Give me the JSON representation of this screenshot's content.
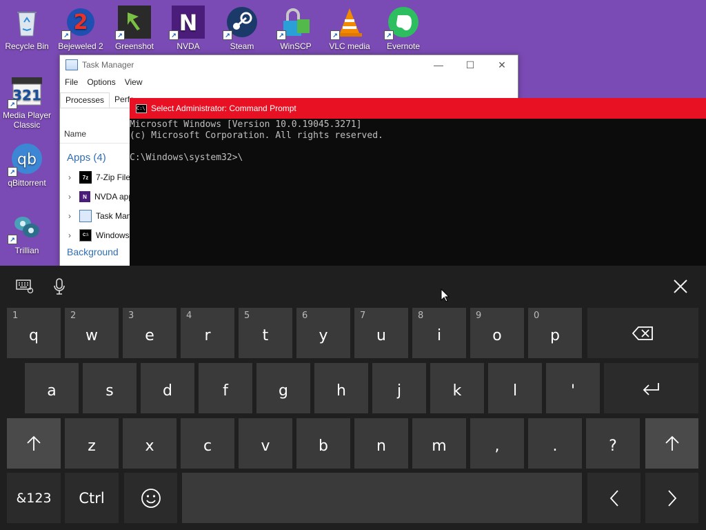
{
  "desktop": {
    "icons": [
      {
        "label": "Recycle Bin"
      },
      {
        "label": "Bejeweled 2"
      },
      {
        "label": "Greenshot"
      },
      {
        "label": "NVDA"
      },
      {
        "label": "Steam"
      },
      {
        "label": "WinSCP"
      },
      {
        "label": "VLC media"
      },
      {
        "label": "Evernote"
      },
      {
        "label": "Media Player Classic"
      },
      {
        "label": "qBittorrent"
      },
      {
        "label": "Trillian"
      }
    ]
  },
  "task_manager": {
    "title": "Task Manager",
    "menu": [
      "File",
      "Options",
      "View"
    ],
    "tabs": [
      "Processes",
      "Perfo"
    ],
    "column_name": "Name",
    "apps_group": "Apps (4)",
    "apps": [
      "7-Zip File",
      "NVDA app",
      "Task Man",
      "Windows"
    ],
    "background_group": "Background"
  },
  "cmd": {
    "title": "Select Administrator: Command Prompt",
    "lines": [
      "Microsoft Windows [Version 10.0.19045.3271]",
      "(c) Microsoft Corporation. All rights reserved.",
      "",
      "C:\\Windows\\system32>\\"
    ]
  },
  "keyboard": {
    "row1": [
      {
        "hint": "1",
        "label": "q"
      },
      {
        "hint": "2",
        "label": "w"
      },
      {
        "hint": "3",
        "label": "e"
      },
      {
        "hint": "4",
        "label": "r"
      },
      {
        "hint": "5",
        "label": "t"
      },
      {
        "hint": "6",
        "label": "y"
      },
      {
        "hint": "7",
        "label": "u"
      },
      {
        "hint": "8",
        "label": "i"
      },
      {
        "hint": "9",
        "label": "o"
      },
      {
        "hint": "0",
        "label": "p"
      }
    ],
    "row2": [
      "a",
      "s",
      "d",
      "f",
      "g",
      "h",
      "j",
      "k",
      "l",
      "'"
    ],
    "row3": [
      "z",
      "x",
      "c",
      "v",
      "b",
      "n",
      "m",
      ",",
      ".",
      "?"
    ],
    "symbols_label": "&123",
    "ctrl_label": "Ctrl",
    "backspace_icon": "backspace-icon",
    "enter_icon": "enter-icon",
    "shift_icon": "shift-up-arrow-icon",
    "emoji_icon": "emoji-icon",
    "left_icon": "chevron-left-icon",
    "right_icon": "chevron-right-icon",
    "keyboard_settings_icon": "keyboard-icon",
    "mic_icon": "microphone-icon",
    "close_icon": "close-icon"
  },
  "colors": {
    "desktop_bg": "#7b4bb5",
    "cmd_titlebar": "#e81123",
    "keyboard_bg": "#1f1f1f",
    "key_bg": "#3a3a3a"
  }
}
